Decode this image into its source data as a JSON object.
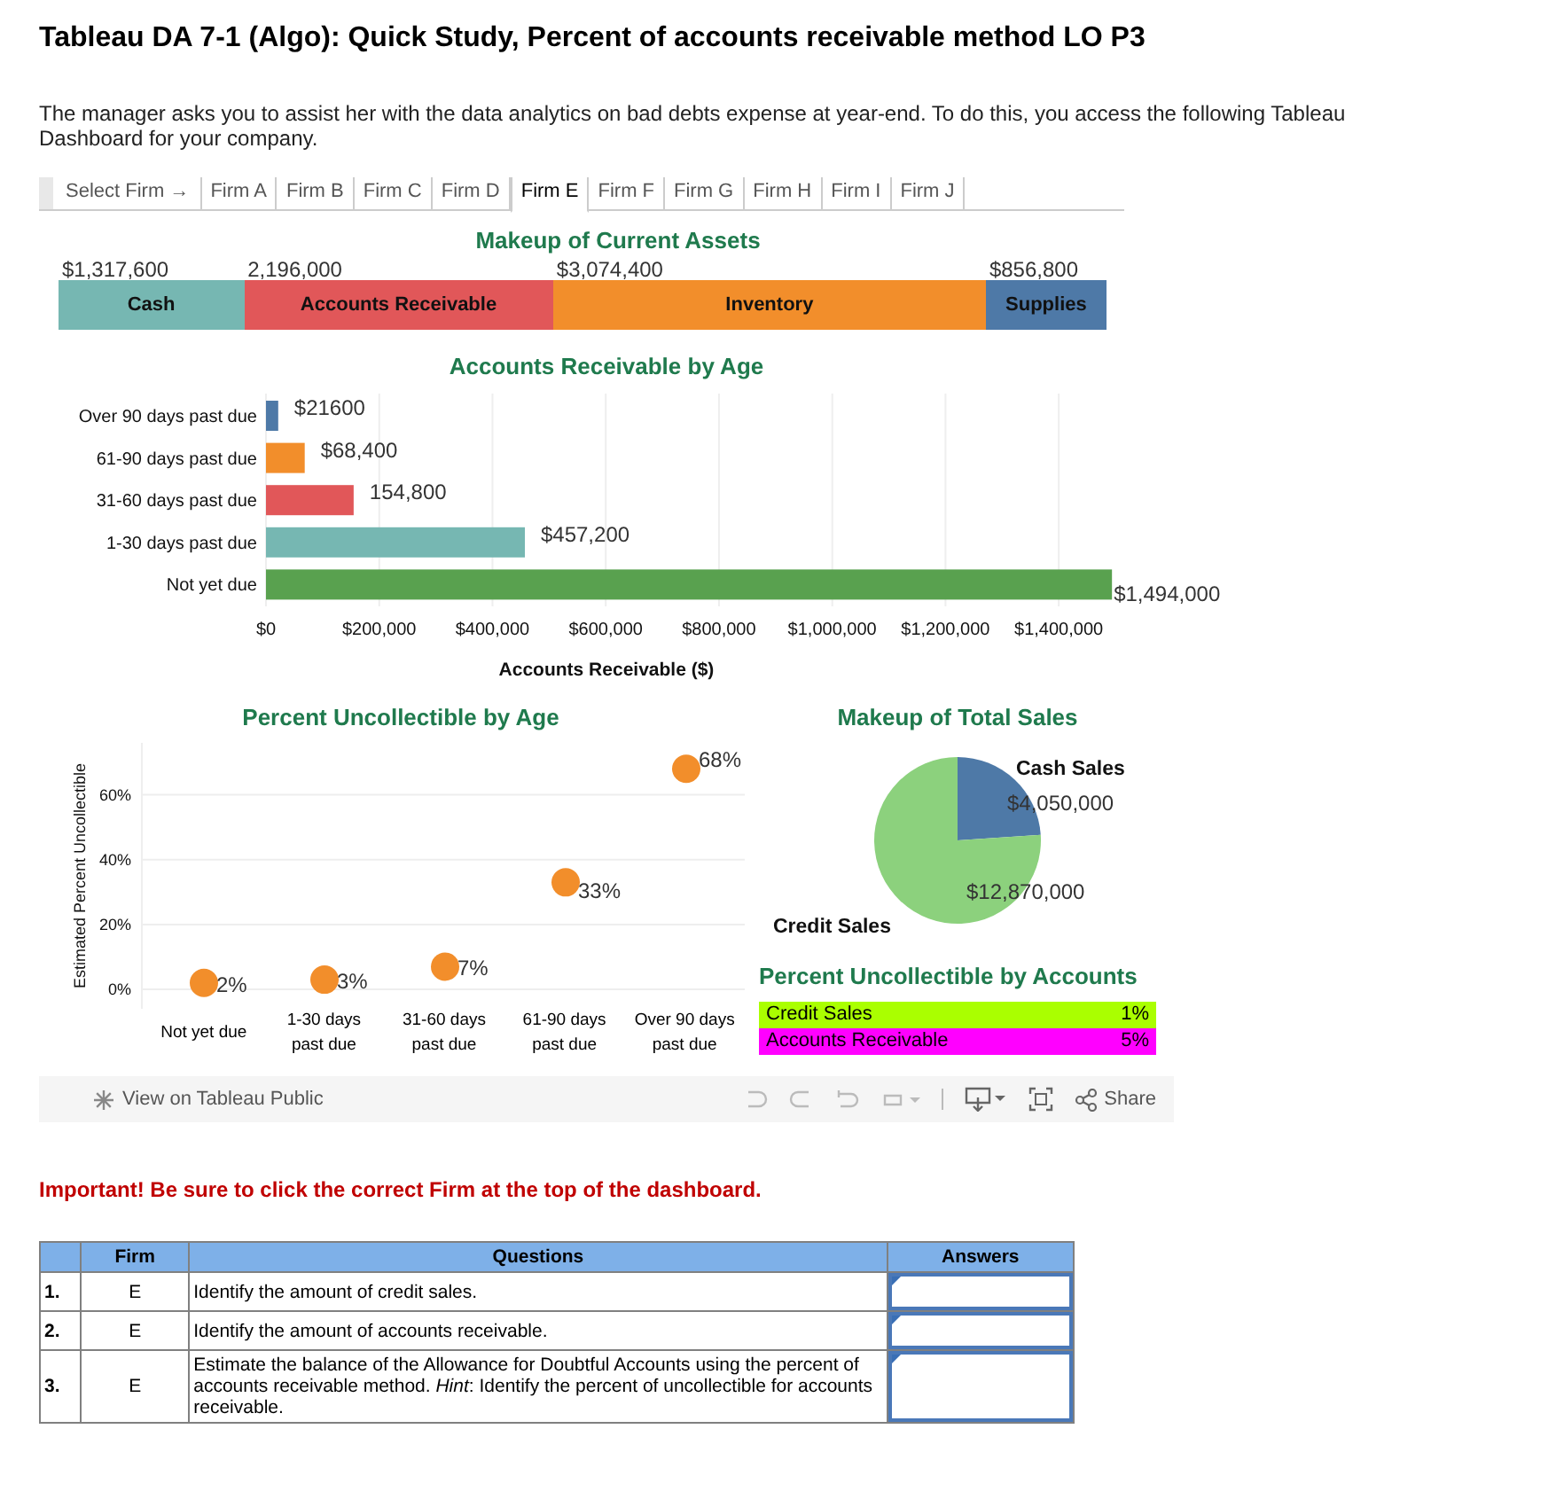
{
  "title": "Tableau DA 7-1 (Algo): Quick Study, Percent of accounts receivable method LO P3",
  "intro": "The manager asks you to assist her with the data analytics on bad debts expense at year-end. To do this, you access the following Tableau Dashboard for your company.",
  "dashboard": {
    "firm_tabs": {
      "label": "Select Firm →",
      "tabs": [
        {
          "label": "Firm A",
          "selected": false
        },
        {
          "label": "Firm B",
          "selected": false
        },
        {
          "label": "Firm C",
          "selected": false
        },
        {
          "label": "Firm D",
          "selected": false
        },
        {
          "label": "Firm E",
          "selected": true
        },
        {
          "label": "Firm F",
          "selected": false
        },
        {
          "label": "Firm G",
          "selected": false
        },
        {
          "label": "Firm H",
          "selected": false
        },
        {
          "label": "Firm I",
          "selected": false
        },
        {
          "label": "Firm J",
          "selected": false
        }
      ]
    },
    "current_assets": {
      "chart_data": {
        "type": "bar",
        "title": "Makeup of Current Assets",
        "orientation": "horizontal",
        "stacked": true,
        "categories": [
          null
        ],
        "series": [
          {
            "name": "Cash",
            "color": "#76b7b2",
            "values": [
              1317600
            ],
            "value_labels": [
              "$1,317,600"
            ]
          },
          {
            "name": "Accounts Receivable",
            "color": "#e15759",
            "values": [
              2196000
            ],
            "value_labels": [
              "2,196,000"
            ]
          },
          {
            "name": "Inventory",
            "color": "#f28e2b",
            "values": [
              3074400
            ],
            "value_labels": [
              "$3,074,400"
            ]
          },
          {
            "name": "Supplies",
            "color": "#4e79a7",
            "values": [
              856800
            ],
            "value_labels": [
              "$856,800"
            ]
          }
        ]
      }
    },
    "receivable_by_age": {
      "chart_data": {
        "type": "bar",
        "title": "Accounts Receivable by Age",
        "orientation": "horizontal",
        "xlabel": "Accounts Receivable ($)",
        "grid": true,
        "categories": [
          "Over 90 days past due",
          "61-90 days past due",
          "31-60 days past due",
          "1-30 days past due",
          "Not yet due"
        ],
        "values": [
          21600,
          68400,
          154800,
          457200,
          1494000
        ],
        "colors": [
          "#4e79a7",
          "#f28e2b",
          "#e15759",
          "#76b7b2",
          "#59a14f"
        ],
        "value_labels": [
          "$21600",
          "$68,400",
          "154,800",
          "$457,200",
          "$1,494,000"
        ],
        "xlim": [
          0,
          1500000
        ],
        "xticks": [
          {
            "value": 0,
            "label": "$0"
          },
          {
            "value": 200000,
            "label": "$200,000"
          },
          {
            "value": 400000,
            "label": "$400,000"
          },
          {
            "value": 600000,
            "label": "$600,000"
          },
          {
            "value": 800000,
            "label": "$800,000"
          },
          {
            "value": 1000000,
            "label": "$1,000,000"
          },
          {
            "value": 1200000,
            "label": "$1,200,000"
          },
          {
            "value": 1400000,
            "label": "$1,400,000"
          }
        ]
      }
    },
    "uncollectible_by_age": {
      "chart_data": {
        "type": "scatter",
        "title": "Percent Uncollectible by Age",
        "ylabel": "Estimated Percent Uncollectible",
        "categories": [
          "Not yet due",
          "1-30 days past due",
          "31-60 days past due",
          "61-90 days past due",
          "Over 90 days past due"
        ],
        "values": [
          2,
          3,
          7,
          33,
          68
        ],
        "value_labels": [
          "2%",
          "3%",
          "7%",
          "33%",
          "68%"
        ],
        "ylim": [
          -6,
          76
        ],
        "grid": true,
        "yticks": [
          {
            "value": 0,
            "label": "0%"
          },
          {
            "value": 20,
            "label": "20%"
          },
          {
            "value": 40,
            "label": "40%"
          },
          {
            "value": 60,
            "label": "60%"
          }
        ]
      }
    },
    "total_sales": {
      "chart_data": {
        "type": "pie",
        "title": "Makeup of Total Sales",
        "categories": [
          "Cash Sales",
          "Credit Sales"
        ],
        "values": [
          4050000,
          12870000
        ],
        "colors": [
          "#4e79a7",
          "#8cd17d"
        ],
        "value_labels": [
          "$4,050,000",
          "$12,870,000"
        ]
      }
    },
    "uncollectible_by_accounts": {
      "title": "Percent Uncollectible by Accounts",
      "rows": [
        {
          "label": "Credit Sales",
          "value": "1%",
          "color": "#aaff00"
        },
        {
          "label": "Accounts Receivable",
          "value": "5%",
          "color": "#ff00ff"
        }
      ]
    },
    "toolbar": {
      "view_link": "View on Tableau Public",
      "share": "Share"
    }
  },
  "important": "Important! Be sure to click the correct Firm at the top of the dashboard.",
  "questions": {
    "columns": [
      "Firm",
      "Questions",
      "Answers"
    ],
    "rows": [
      {
        "number": "1.",
        "firm": "E",
        "question": "Identify the amount of credit sales."
      },
      {
        "number": "2.",
        "firm": "E",
        "question": "Identify the amount of accounts receivable."
      },
      {
        "number": "3.",
        "firm": "E",
        "question": "Estimate the balance of the Allowance for Doubtful Accounts using the percent of accounts receivable method. *Hint*: Identify the percent of uncollectible for accounts receivable."
      }
    ]
  }
}
